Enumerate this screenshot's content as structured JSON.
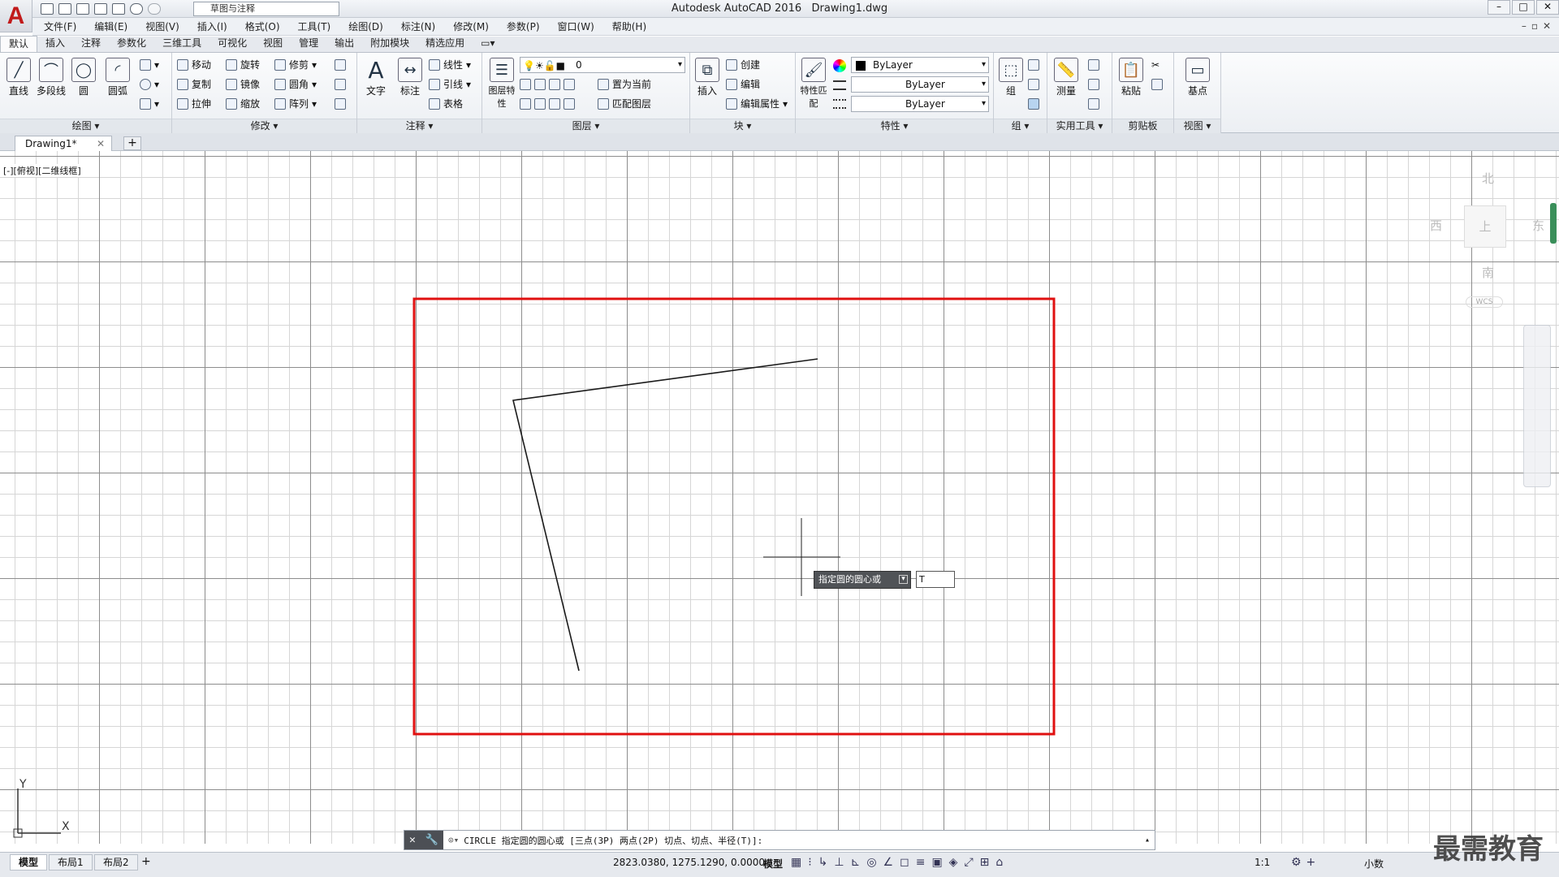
{
  "window": {
    "title": "Autodesk AutoCAD 2016",
    "document": "Drawing1.dwg",
    "app_letter": "A"
  },
  "quick_access": {
    "workspace": "草图与注释"
  },
  "menu": [
    "文件(F)",
    "编辑(E)",
    "视图(V)",
    "插入(I)",
    "格式(O)",
    "工具(T)",
    "绘图(D)",
    "标注(N)",
    "修改(M)",
    "参数(P)",
    "窗口(W)",
    "帮助(H)"
  ],
  "ribbon_tabs": [
    "默认",
    "插入",
    "注释",
    "参数化",
    "三维工具",
    "可视化",
    "视图",
    "管理",
    "输出",
    "附加模块",
    "精选应用"
  ],
  "panels": {
    "draw": {
      "title": "绘图",
      "tools": [
        "直线",
        "多段线",
        "圆",
        "圆弧"
      ]
    },
    "modify": {
      "title": "修改",
      "tools": [
        "移动",
        "旋转",
        "修剪",
        "复制",
        "镜像",
        "圆角",
        "拉伸",
        "缩放",
        "阵列"
      ]
    },
    "annotation": {
      "title": "注释",
      "tools": [
        "文字",
        "标注",
        "线性",
        "引线",
        "表格"
      ]
    },
    "layers": {
      "title": "图层",
      "layer_props": "图层特性",
      "current_layer": "0",
      "set_current": "置为当前",
      "match_layer": "匹配图层"
    },
    "block": {
      "title": "块",
      "insert": "插入",
      "create": "创建",
      "edit": "编辑",
      "edit_attr": "编辑属性"
    },
    "properties": {
      "title": "特性",
      "match": "特性匹配",
      "color": "ByLayer",
      "linetype": "ByLayer",
      "lineweight": "ByLayer"
    },
    "groups": {
      "title": "组",
      "group": "组"
    },
    "utilities": {
      "title": "实用工具",
      "measure": "测量"
    },
    "clipboard": {
      "title": "剪贴板",
      "paste": "粘贴"
    },
    "view": {
      "title": "视图",
      "base": "基点"
    }
  },
  "doc_tab": "Drawing1*",
  "viewport_label": "[-][俯视][二维线框]",
  "viewcube": {
    "north": "北",
    "south": "南",
    "east": "东",
    "west": "西",
    "top": "上",
    "wcs": "WCS"
  },
  "ucs": {
    "x": "X",
    "y": "Y"
  },
  "command": {
    "text": "CIRCLE 指定圆的圆心或 [三点(3P) 两点(2P) 切点、切点、半径(T)]:"
  },
  "dynamic_input": {
    "prompt": "指定圆的圆心或",
    "value": "T"
  },
  "layout_tabs": [
    "模型",
    "布局1",
    "布局2"
  ],
  "status": {
    "coords": "2823.0380, 1275.1290, 0.0000",
    "space": "模型",
    "scale": "1:1",
    "units": "小数"
  },
  "watermark": "最需教育",
  "colors": {
    "boundary": "#e01010",
    "lines": "#1a1a1a"
  }
}
